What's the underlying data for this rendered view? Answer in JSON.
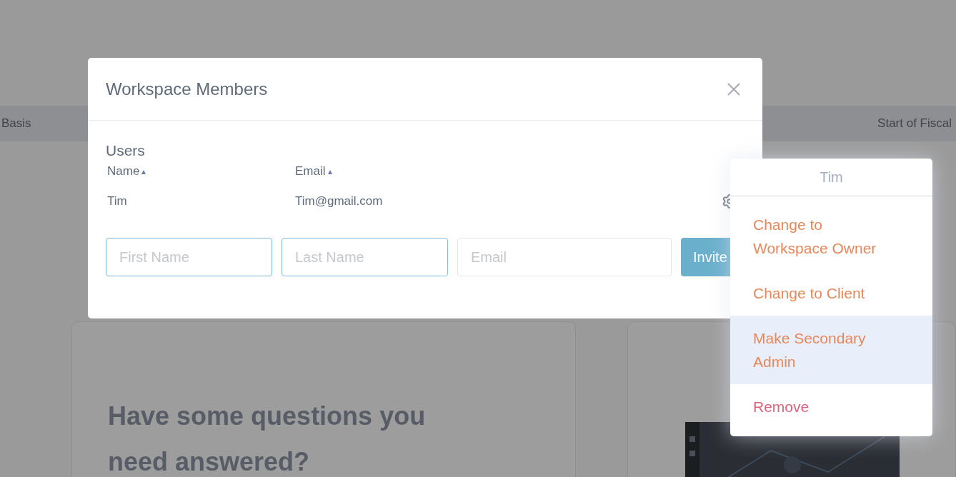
{
  "background": {
    "header_left": "Basis",
    "header_right": "Start of Fiscal",
    "card_heading": "Have some questions you need answered?"
  },
  "modal": {
    "title": "Workspace Members",
    "section": "Users",
    "columns": [
      {
        "label": "Name",
        "sort": "▴"
      },
      {
        "label": "Email",
        "sort": "▴"
      }
    ],
    "rows": [
      {
        "name": "Tim",
        "email": "Tim@gmail.com"
      }
    ],
    "fields": [
      {
        "placeholder": "First Name",
        "focused": true
      },
      {
        "placeholder": "Last Name",
        "focused": true
      },
      {
        "placeholder": "Email",
        "focused": false
      }
    ],
    "invite_button": "Invite"
  },
  "menu": {
    "title": "Tim",
    "items": [
      {
        "label": "Change to Workspace Owner",
        "kind": "action",
        "selected": false
      },
      {
        "label": "Change to Client",
        "kind": "action",
        "selected": false
      },
      {
        "label": "Make Secondary Admin",
        "kind": "action",
        "selected": true
      },
      {
        "label": "Remove",
        "kind": "danger",
        "selected": false
      }
    ]
  }
}
